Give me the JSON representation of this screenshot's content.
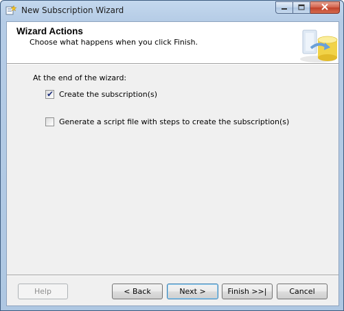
{
  "window": {
    "title": "New Subscription Wizard"
  },
  "header": {
    "title": "Wizard Actions",
    "subtitle": "Choose what happens when you click Finish."
  },
  "content": {
    "group_label": "At the end of the wizard:",
    "options": [
      {
        "label": "Create the subscription(s)",
        "checked": true
      },
      {
        "label": "Generate a script file with steps to create the subscription(s)",
        "checked": false
      }
    ]
  },
  "buttons": {
    "help": "Help",
    "back": "< Back",
    "next": "Next >",
    "finish": "Finish >>|",
    "cancel": "Cancel"
  },
  "icons": {
    "app": "wizard-app-icon",
    "header_art": "database-arrow-icon"
  },
  "colors": {
    "accent": "#3c7fb1",
    "checkmark": "#1d2f7a"
  }
}
